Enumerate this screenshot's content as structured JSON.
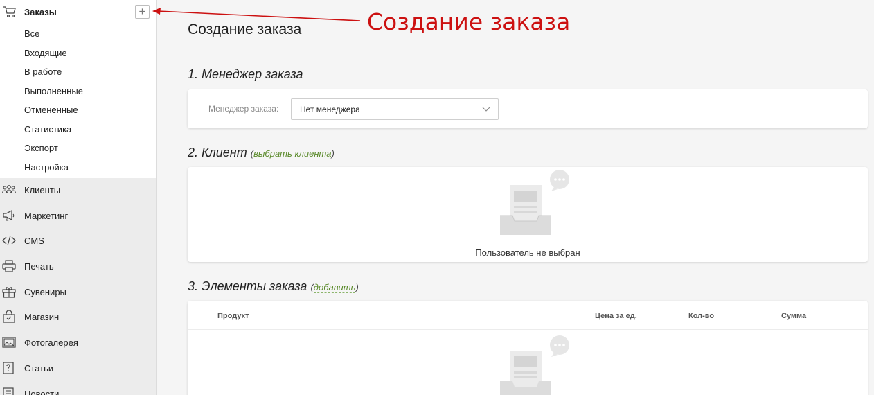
{
  "sidebar": {
    "active_section": {
      "icon": "cart-icon",
      "label": "Заказы",
      "add_button": "+",
      "items": [
        {
          "label": "Все"
        },
        {
          "label": "Входящие"
        },
        {
          "label": "В работе"
        },
        {
          "label": "Выполненные"
        },
        {
          "label": "Отмененные"
        },
        {
          "label": "Статистика"
        },
        {
          "label": "Экспорт"
        },
        {
          "label": "Настройка"
        }
      ]
    },
    "items": [
      {
        "label": "Клиенты",
        "icon": "users-icon"
      },
      {
        "label": "Маркетинг",
        "icon": "megaphone-icon"
      },
      {
        "label": "CMS",
        "icon": "code-icon"
      },
      {
        "label": "Печать",
        "icon": "printer-icon"
      },
      {
        "label": "Сувениры",
        "icon": "gift-icon"
      },
      {
        "label": "Магазин",
        "icon": "shop-icon"
      },
      {
        "label": "Фотогалерея",
        "icon": "gallery-icon"
      },
      {
        "label": "Статьи",
        "icon": "question-icon"
      },
      {
        "label": "Новости",
        "icon": "news-icon"
      }
    ]
  },
  "page": {
    "title": "Создание заказа",
    "section1": {
      "title": "1. Менеджер заказа",
      "field_label": "Менеджер заказа:",
      "select_value": "Нет менеджера"
    },
    "section2": {
      "title": "2. Клиент",
      "paren_open": "(",
      "link": "выбрать клиента",
      "paren_close": ")",
      "empty_text": "Пользователь не выбран"
    },
    "section3": {
      "title": "3. Элементы заказа",
      "paren_open": "(",
      "link": "добавить",
      "paren_close": ")",
      "columns": [
        "Продукт",
        "Цена за ед.",
        "Кол-во",
        "Сумма"
      ]
    }
  },
  "annotation": {
    "text": "Создание заказа",
    "color": "#cc1111"
  },
  "colors": {
    "accent_link": "#5a8a2a",
    "sidebar_bg": "#ececec",
    "content_bg": "#f5f5f5"
  }
}
